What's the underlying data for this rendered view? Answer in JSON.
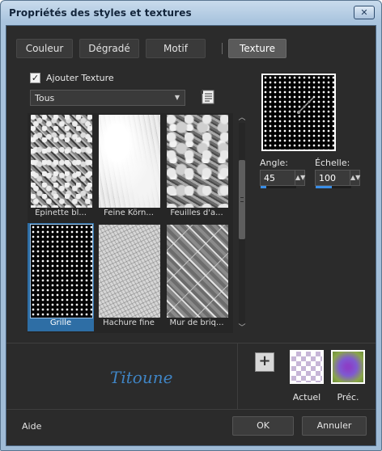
{
  "window": {
    "title": "Propriétés des styles et textures",
    "close_glyph": "✕"
  },
  "tabs": [
    {
      "label": "Couleur",
      "active": false
    },
    {
      "label": "Dégradé",
      "active": false
    },
    {
      "label": "Motif",
      "active": false
    },
    {
      "label": "Texture",
      "active": true
    }
  ],
  "texture_panel": {
    "add_texture_label": "Ajouter Texture",
    "add_texture_checked": true,
    "checkmark": "✓",
    "category_value": "Tous",
    "category_arrow": "▼",
    "doc_icon": "document-list-icon",
    "thumbnails": [
      {
        "label": "Épinette bl...",
        "selected": false,
        "pattern": "spruce"
      },
      {
        "label": "Feine Körn...",
        "selected": false,
        "pattern": "fine-grain"
      },
      {
        "label": "Feuilles d'a...",
        "selected": false,
        "pattern": "leaves"
      },
      {
        "label": "Grille",
        "selected": true,
        "pattern": "grid-dots"
      },
      {
        "label": "Hachure fine",
        "selected": false,
        "pattern": "hatch"
      },
      {
        "label": "Mur de briq...",
        "selected": false,
        "pattern": "brick"
      }
    ],
    "scroll_up_glyph": "︿",
    "scroll_down_glyph": "﹀"
  },
  "preview": {
    "angle_label": "Angle:",
    "angle_value": "45",
    "angle_level": 0.15,
    "scale_label": "Échelle:",
    "scale_value": "100",
    "scale_level": 0.45,
    "spin_arrow": "▲▼"
  },
  "footer_panel": {
    "logo_text": "Titoune",
    "add_glyph": "+",
    "current_label": "Actuel",
    "previous_label": "Préc."
  },
  "buttons": {
    "help": "Aide",
    "ok": "OK",
    "cancel": "Annuler"
  },
  "colors": {
    "accent": "#2e6ea5",
    "level_fill": "#3a8ee6",
    "logo": "#3f84c4"
  }
}
